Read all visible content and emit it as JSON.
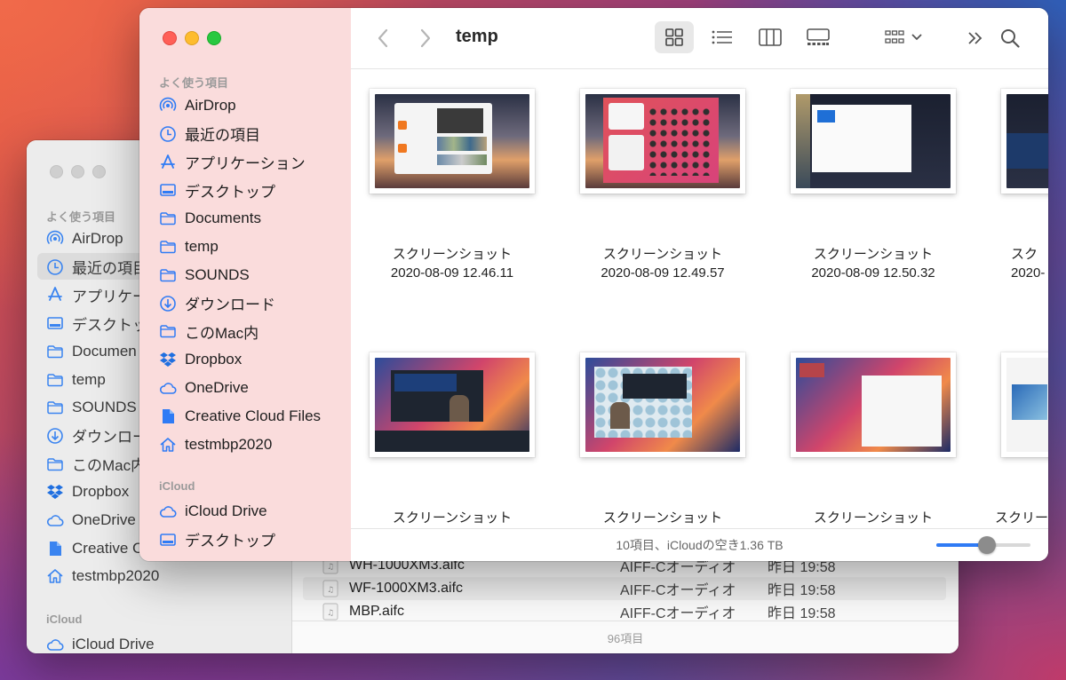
{
  "back_window": {
    "sidebar_section_favorites": "よく使う項目",
    "sidebar_items": [
      {
        "label": "AirDrop",
        "icon": "airdrop-icon"
      },
      {
        "label": "最近の項目",
        "icon": "clock-icon"
      },
      {
        "label": "アプリケー",
        "icon": "applications-icon"
      },
      {
        "label": "デスクトッ",
        "icon": "desktop-icon"
      },
      {
        "label": "Documen",
        "icon": "folder-icon"
      },
      {
        "label": "temp",
        "icon": "folder-icon"
      },
      {
        "label": "SOUNDS",
        "icon": "folder-icon"
      },
      {
        "label": "ダウンロー",
        "icon": "download-icon"
      },
      {
        "label": "このMac内",
        "icon": "folder-icon"
      },
      {
        "label": "Dropbox",
        "icon": "dropbox-icon"
      },
      {
        "label": "OneDrive",
        "icon": "cloud-icon"
      },
      {
        "label": "Creative C",
        "icon": "document-icon"
      },
      {
        "label": "testmbp2020",
        "icon": "home-icon"
      }
    ],
    "sidebar_section_icloud": "iCloud",
    "icloud_items": [
      {
        "label": "iCloud Drive",
        "icon": "cloud-icon"
      }
    ],
    "files": [
      {
        "name": "WH-1000XM3.aifc",
        "kind": "AIFF-Cオーディオ",
        "date": "昨日 19:58"
      },
      {
        "name": "WF-1000XM3.aifc",
        "kind": "AIFF-Cオーディオ",
        "date": "昨日 19:58"
      },
      {
        "name": "MBP.aifc",
        "kind": "AIFF-Cオーディオ",
        "date": "昨日 19:58"
      }
    ],
    "status": "96項目"
  },
  "front_window": {
    "title": "temp",
    "sidebar_section_favorites": "よく使う項目",
    "sidebar_items": [
      {
        "label": "AirDrop",
        "icon": "airdrop-icon"
      },
      {
        "label": "最近の項目",
        "icon": "clock-icon"
      },
      {
        "label": "アプリケーション",
        "icon": "applications-icon"
      },
      {
        "label": "デスクトップ",
        "icon": "desktop-icon"
      },
      {
        "label": "Documents",
        "icon": "folder-icon"
      },
      {
        "label": "temp",
        "icon": "folder-icon"
      },
      {
        "label": "SOUNDS",
        "icon": "folder-icon"
      },
      {
        "label": "ダウンロード",
        "icon": "download-icon"
      },
      {
        "label": "このMac内",
        "icon": "folder-icon"
      },
      {
        "label": "Dropbox",
        "icon": "dropbox-icon"
      },
      {
        "label": "OneDrive",
        "icon": "cloud-icon"
      },
      {
        "label": "Creative Cloud Files",
        "icon": "document-icon"
      },
      {
        "label": "testmbp2020",
        "icon": "home-icon"
      }
    ],
    "sidebar_section_icloud": "iCloud",
    "icloud_items": [
      {
        "label": "iCloud Drive",
        "icon": "cloud-icon"
      },
      {
        "label": "デスクトップ",
        "icon": "desktop-icon"
      }
    ],
    "files": [
      {
        "line1": "スクリーンショット",
        "line2": "2020-08-09 12.46.11"
      },
      {
        "line1": "スクリーンショット",
        "line2": "2020-08-09 12.49.57"
      },
      {
        "line1": "スクリーンショット",
        "line2": "2020-08-09 12.50.32"
      },
      {
        "line1": "スク",
        "line2": "2020-"
      },
      {
        "line1": "スクリーンショット",
        "line2": ""
      },
      {
        "line1": "スクリーンショット",
        "line2": ""
      },
      {
        "line1": "スクリーンショット",
        "line2": ""
      },
      {
        "line1": "スクリーン",
        "line2": ""
      }
    ],
    "status": "10項目、iCloudの空き1.36 TB",
    "zoom_level": 0.55
  },
  "colors": {
    "sidebar_pink": "#fadcdc",
    "accent_blue": "#2f7bf5",
    "close_red": "#ff5f57",
    "minimize_yellow": "#febc2e",
    "zoom_green": "#28c840"
  }
}
